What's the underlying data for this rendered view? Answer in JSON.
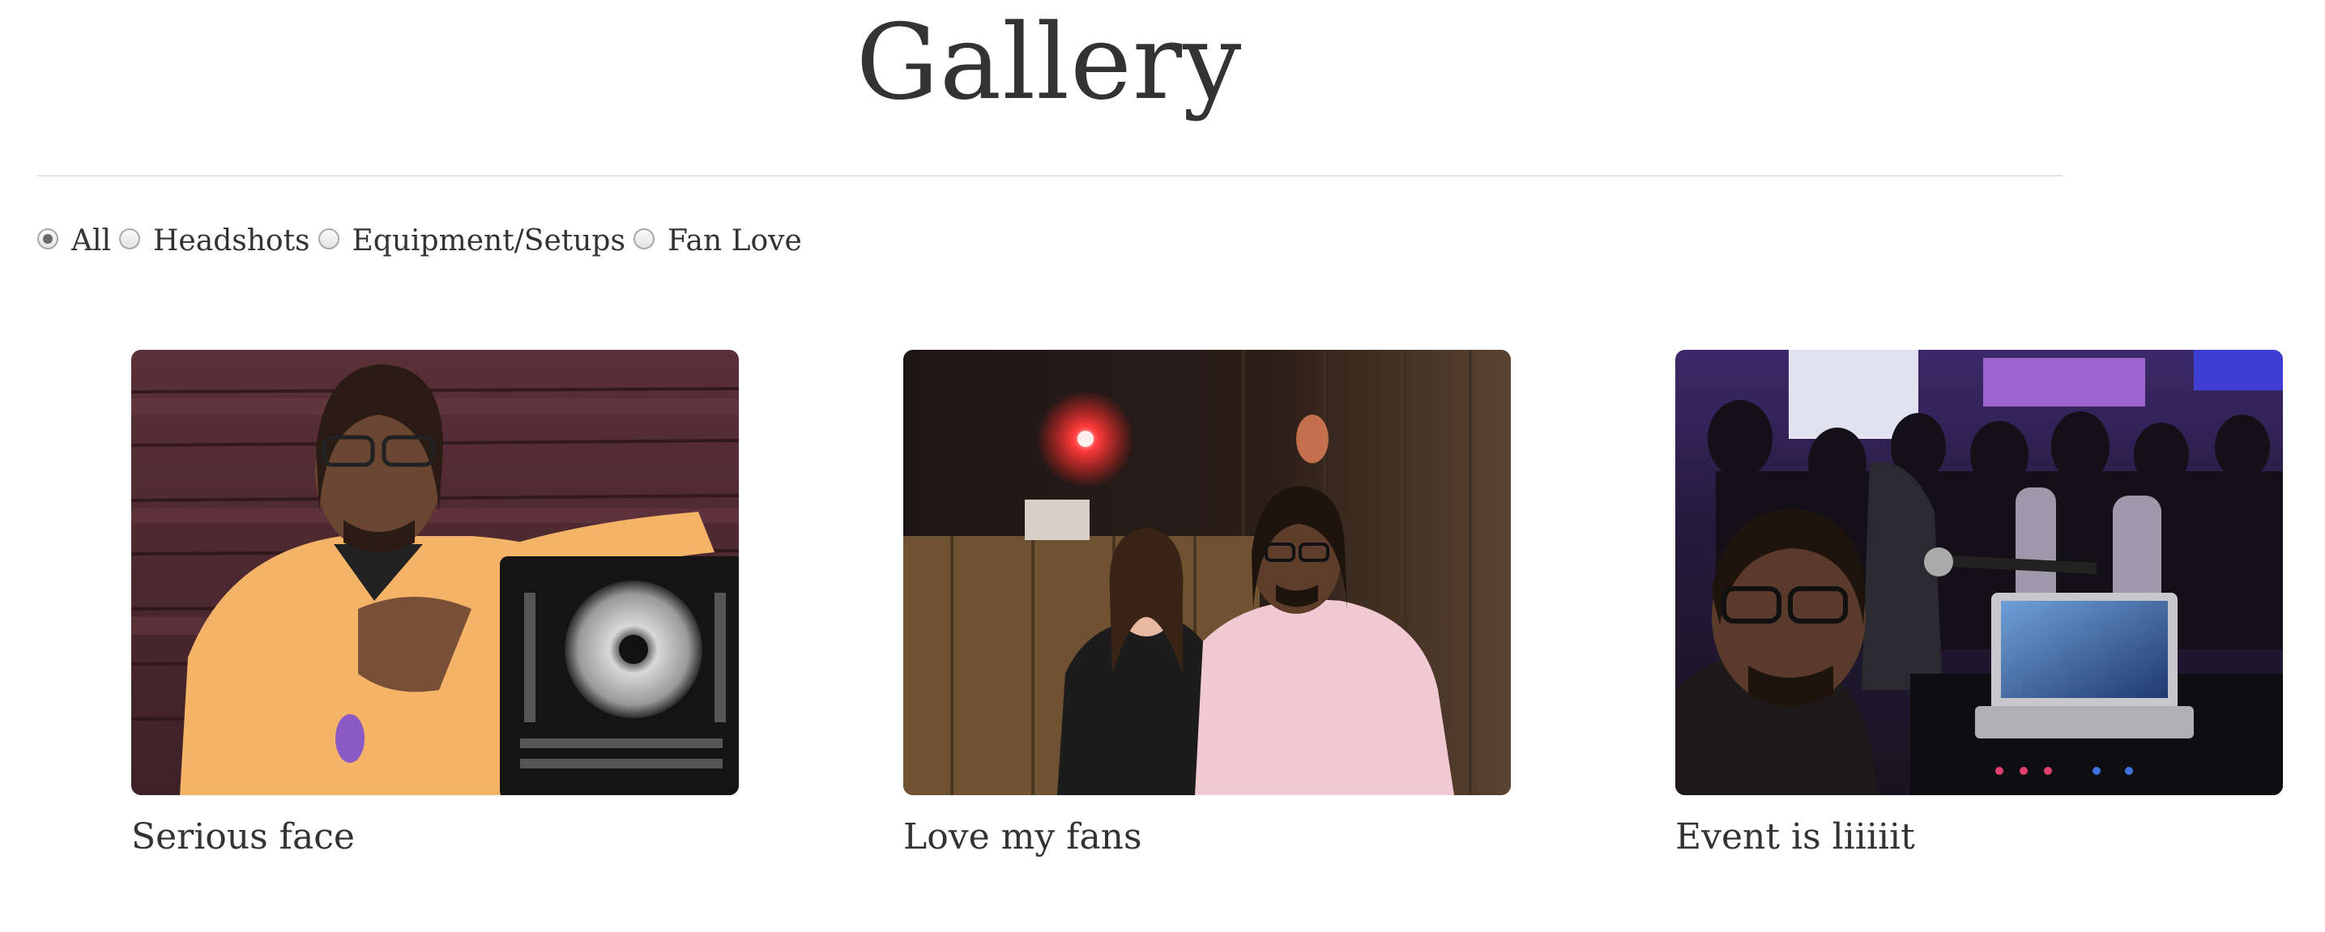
{
  "page": {
    "title": "Gallery"
  },
  "filters": [
    {
      "label": "All",
      "checked": true
    },
    {
      "label": "Headshots",
      "checked": false
    },
    {
      "label": "Equipment/Setups",
      "checked": false
    },
    {
      "label": "Fan Love",
      "checked": false
    }
  ],
  "gallery": {
    "items": [
      {
        "caption": "Serious face"
      },
      {
        "caption": "Love my fans"
      },
      {
        "caption": "Event is liiiiit"
      }
    ]
  },
  "colors": {
    "text": "#333333",
    "divider": "#e3e3e3",
    "radio_border": "#a9a9a9"
  }
}
